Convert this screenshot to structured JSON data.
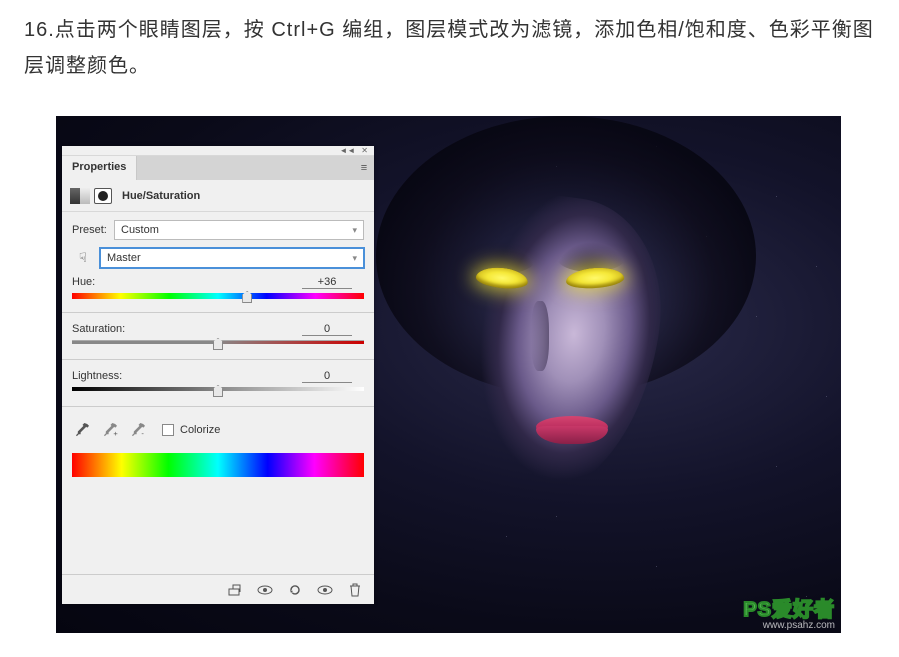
{
  "instruction": "16.点击两个眼睛图层，按 Ctrl+G 编组，图层模式改为滤镜，添加色相/饱和度、色彩平衡图层调整颜色。",
  "panel": {
    "tab": "Properties",
    "title": "Hue/Saturation",
    "preset_label": "Preset:",
    "preset_value": "Custom",
    "channel_value": "Master",
    "hue": {
      "label": "Hue:",
      "value": "+36",
      "pos_pct": 60
    },
    "saturation": {
      "label": "Saturation:",
      "value": "0",
      "pos_pct": 50
    },
    "lightness": {
      "label": "Lightness:",
      "value": "0",
      "pos_pct": 50
    },
    "colorize_label": "Colorize"
  },
  "watermark": {
    "brand_ps": "PS",
    "brand_rest": "爱好者",
    "url": "www.psahz.com"
  },
  "colors": {
    "panel_bg": "#f0f0f0",
    "accent": "#4a90d9",
    "eye_glow": "#f5e838",
    "lips": "#c83868"
  }
}
